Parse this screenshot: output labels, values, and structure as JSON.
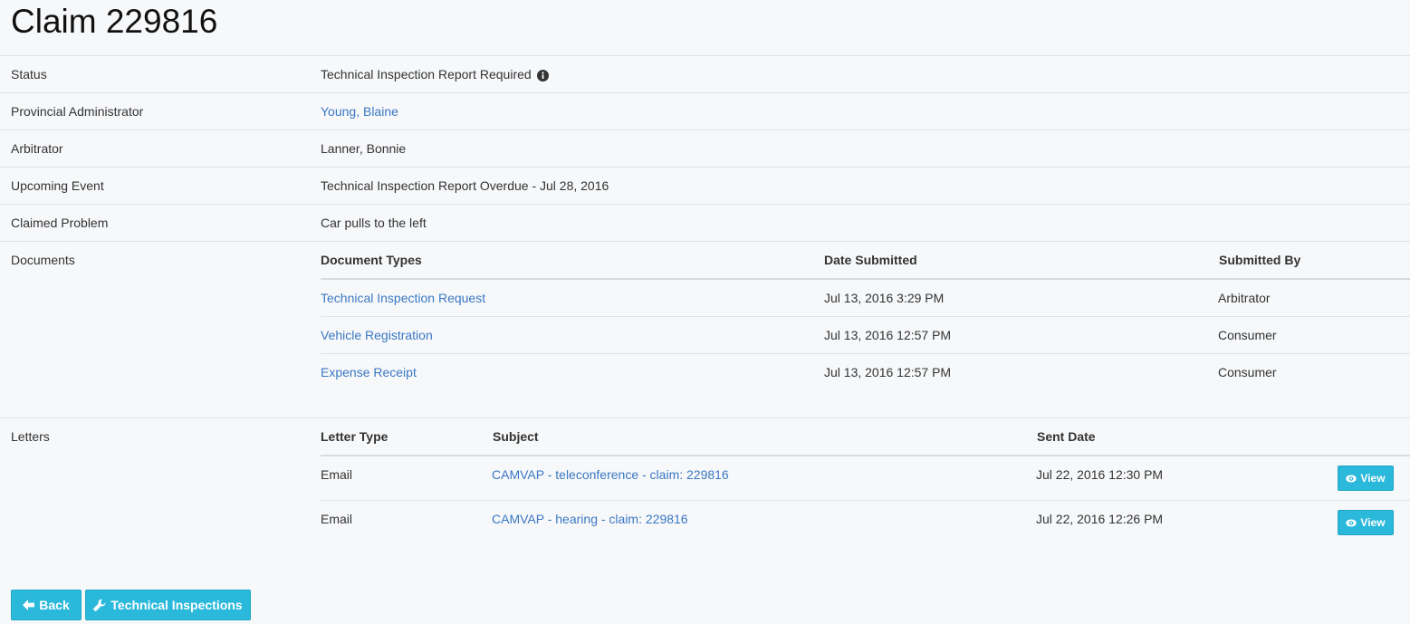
{
  "title": "Claim 229816",
  "details": {
    "status_label": "Status",
    "status_value": "Technical Inspection Report Required",
    "admin_label": "Provincial Administrator",
    "admin_value": "Young, Blaine",
    "arbitrator_label": "Arbitrator",
    "arbitrator_value": "Lanner, Bonnie",
    "event_label": "Upcoming Event",
    "event_value": "Technical Inspection Report Overdue - Jul 28, 2016",
    "problem_label": "Claimed Problem",
    "problem_value": "Car pulls to the left"
  },
  "documents": {
    "label": "Documents",
    "headers": [
      "Document Types",
      "Date Submitted",
      "Submitted By"
    ],
    "rows": [
      {
        "type": "Technical Inspection Request",
        "date": "Jul 13, 2016 3:29 PM",
        "by": "Arbitrator"
      },
      {
        "type": "Vehicle Registration",
        "date": "Jul 13, 2016 12:57 PM",
        "by": "Consumer"
      },
      {
        "type": "Expense Receipt",
        "date": "Jul 13, 2016 12:57 PM",
        "by": "Consumer"
      }
    ]
  },
  "letters": {
    "label": "Letters",
    "headers": [
      "Letter Type",
      "Subject",
      "Sent Date"
    ],
    "rows": [
      {
        "type": "Email",
        "subject": "CAMVAP - teleconference - claim: 229816",
        "date": "Jul 22, 2016 12:30 PM",
        "action": "View"
      },
      {
        "type": "Email",
        "subject": "CAMVAP - hearing - claim: 229816",
        "date": "Jul 22, 2016 12:26 PM",
        "action": "View"
      }
    ]
  },
  "actions": {
    "back": "Back",
    "tech": "Technical Inspections"
  },
  "colors": {
    "accent": "#2ab8db",
    "link": "#3a78c3",
    "background": "#f7f8fa"
  },
  "icons": {
    "status_info": "info-circle-icon",
    "view": "eye-icon",
    "back": "arrow-left-icon",
    "tech": "wrench-icon"
  }
}
